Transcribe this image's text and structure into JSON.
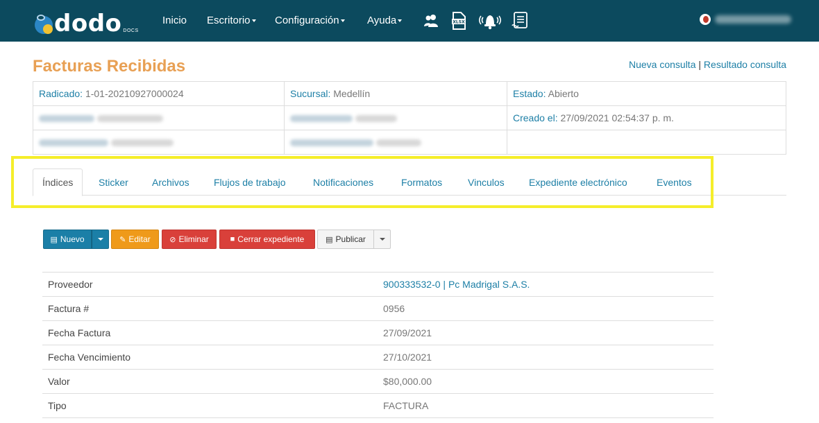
{
  "app": {
    "logo_text": "dodo",
    "logo_sub": "DOCS"
  },
  "nav": {
    "items": [
      {
        "label": "Inicio",
        "dropdown": false
      },
      {
        "label": "Escritorio",
        "dropdown": true
      },
      {
        "label": "Configuración",
        "dropdown": true
      },
      {
        "label": "Ayuda",
        "dropdown": true
      }
    ],
    "icons": [
      "users-icon",
      "xlsx-file-icon",
      "bell-icon",
      "document-list-icon"
    ]
  },
  "page": {
    "title": "Facturas Recibidas",
    "links": [
      "Nueva consulta",
      "Resultado consulta"
    ],
    "link_separator": "|"
  },
  "info": {
    "radicado_label": "Radicado:",
    "radicado_value": "1-01-20210927000024",
    "sucursal_label": "Sucursal:",
    "sucursal_value": "Medellín",
    "estado_label": "Estado:",
    "estado_value": "Abierto",
    "creado_label": "Creado el:",
    "creado_value": "27/09/2021 02:54:37 p. m."
  },
  "tabs": [
    "Índices",
    "Sticker",
    "Archivos",
    "Flujos de trabajo",
    "Notificaciones",
    "Formatos",
    "Vinculos",
    "Expediente electrónico",
    "Eventos"
  ],
  "toolbar": {
    "nuevo": "Nuevo",
    "editar": "Editar",
    "eliminar": "Eliminar",
    "cerrar": "Cerrar expediente",
    "publicar": "Publicar"
  },
  "detail": {
    "rows": [
      {
        "label": "Proveedor",
        "value": "900333532-0 | Pc Madrigal S.A.S."
      },
      {
        "label": "Factura #",
        "value": "0956"
      },
      {
        "label": "Fecha Factura",
        "value": "27/09/2021"
      },
      {
        "label": "Fecha Vencimiento",
        "value": "27/10/2021"
      },
      {
        "label": "Valor",
        "value": "$80,000.00"
      },
      {
        "label": "Tipo",
        "value": "FACTURA"
      }
    ]
  },
  "colors": {
    "navbar": "#0c4a5e",
    "title": "#e8a054",
    "link": "#1d7fa6",
    "highlight": "#f5ee2a"
  }
}
